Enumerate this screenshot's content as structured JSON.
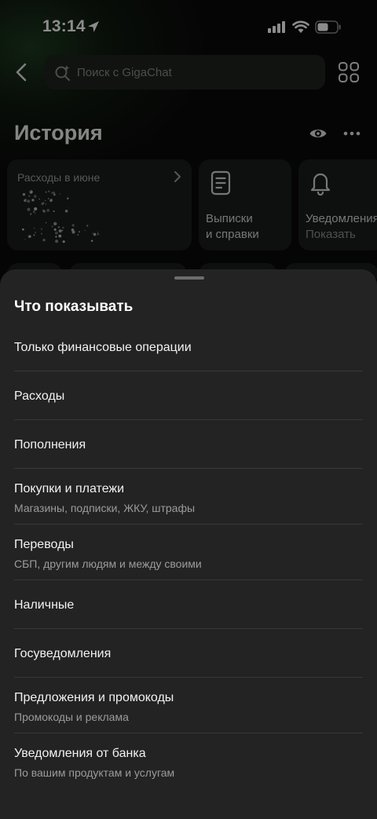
{
  "status_bar": {
    "time": "13:14"
  },
  "header": {
    "search_placeholder": "Поиск с GigaChat",
    "title": "История"
  },
  "cards": {
    "expenses_label": "Расходы в июне",
    "statements_line1": "Выписки",
    "statements_line2": "и справки",
    "notifications_title": "Уведомления",
    "notifications_sub": "Показать"
  },
  "sheet": {
    "title": "Что показывать",
    "options": [
      {
        "title": "Только финансовые операции",
        "subtitle": ""
      },
      {
        "title": "Расходы",
        "subtitle": ""
      },
      {
        "title": "Пополнения",
        "subtitle": ""
      },
      {
        "title": "Покупки и платежи",
        "subtitle": "Магазины, подписки, ЖКУ, штрафы"
      },
      {
        "title": "Переводы",
        "subtitle": "СБП, другим людям и между своими"
      },
      {
        "title": "Наличные",
        "subtitle": ""
      },
      {
        "title": "Госуведомления",
        "subtitle": ""
      },
      {
        "title": "Предложения и промокоды",
        "subtitle": "Промокоды и реклама"
      },
      {
        "title": "Уведомления от банка",
        "subtitle": "По вашим продуктам и услугам"
      }
    ]
  },
  "colors": {
    "sheet_bg": "#232323",
    "separator": "#383838",
    "subtitle_text": "#9b9b9b"
  },
  "icons": [
    "location-arrow-icon",
    "cellular-signal-icon",
    "wifi-icon",
    "battery-icon",
    "back-chevron-icon",
    "gigachat-search-icon",
    "apps-grid-icon",
    "eye-icon",
    "more-dots-icon",
    "chevron-right-icon",
    "document-icon",
    "bell-icon"
  ]
}
